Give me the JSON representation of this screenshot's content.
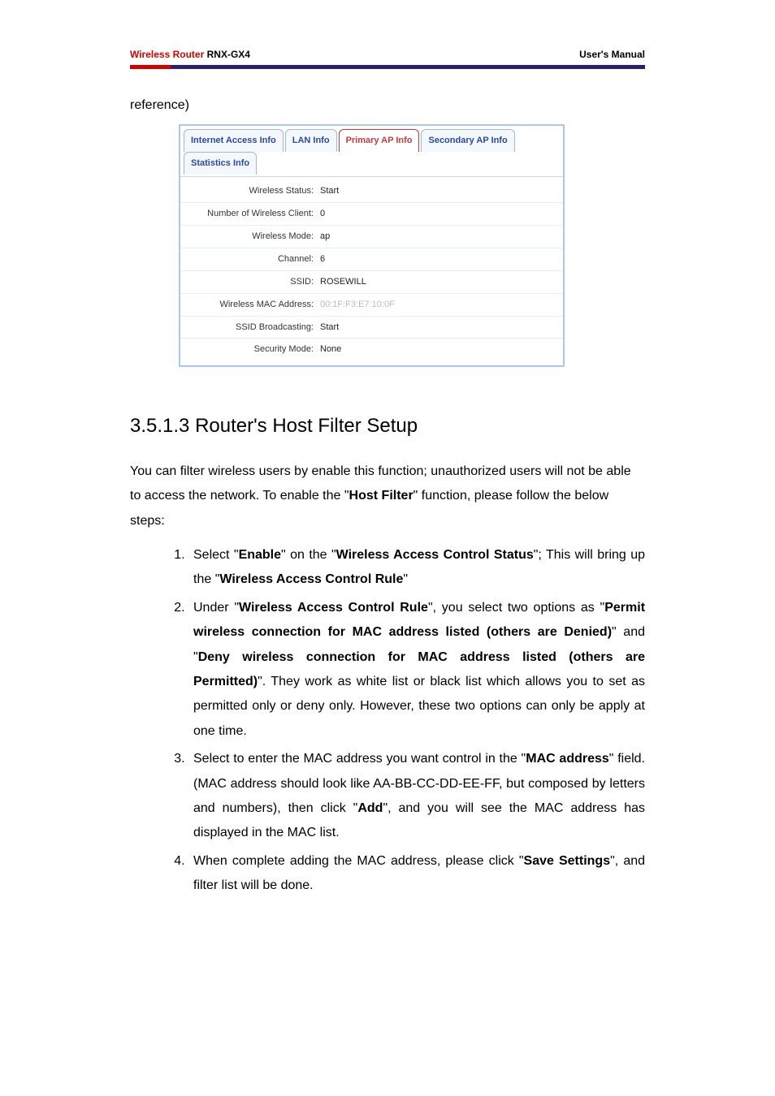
{
  "header": {
    "product_prefix": "Wireless Router",
    "model": "RNX-GX4",
    "right": "User's Manual"
  },
  "ref_line": "reference)",
  "router_ui": {
    "tabs": {
      "internet": "Internet Access Info",
      "lan": "LAN Info",
      "primary": "Primary AP Info",
      "secondary": "Secondary AP Info",
      "stats": "Statistics Info"
    },
    "rows": {
      "wireless_status_label": "Wireless Status:",
      "wireless_status_value": "Start",
      "num_client_label": "Number of Wireless Client:",
      "num_client_value": "0",
      "wireless_mode_label": "Wireless Mode:",
      "wireless_mode_value": "ap",
      "channel_label": "Channel:",
      "channel_value": "6",
      "ssid_label": "SSID:",
      "ssid_value": "ROSEWILL",
      "mac_label": "Wireless MAC Address:",
      "mac_value": "00:1F:F3:E7:10:0F",
      "broadcast_label": "SSID Broadcasting:",
      "broadcast_value": "Start",
      "security_label": "Security Mode:",
      "security_value": "None"
    }
  },
  "section_heading": "3.5.1.3 Router's Host Filter Setup",
  "intro": {
    "p1a": "You can filter wireless users by enable this function; unauthorized users will not be able to access the network. To enable the \"",
    "p1b": "Host Filter",
    "p1c": "\" function, please follow the below steps:"
  },
  "steps": {
    "s1a": "Select \"",
    "s1b": "Enable",
    "s1c": "\" on the \"",
    "s1d": "Wireless Access Control Status",
    "s1e": "\"; This will bring up the \"",
    "s1f": "Wireless Access Control Rule",
    "s1g": "\"",
    "s2a": "Under \"",
    "s2b": "Wireless Access Control Rule",
    "s2c": "\", you select two options as \"",
    "s2d": "Permit wireless connection for MAC address listed (others are Denied)",
    "s2e": "\" and \"",
    "s2f": "Deny wireless connection for MAC address listed (others are Permitted)",
    "s2g": "\". They work as white list or black list which allows you to set as permitted only or deny only. However, these two options can only be apply at one time.",
    "s3a": "Select to enter the MAC address you want control in the \"",
    "s3b": "MAC address",
    "s3c": "\" field. (MAC address should look like AA-BB-CC-DD-EE-FF, but composed by letters and numbers), then click \"",
    "s3d": "Add",
    "s3e": "\", and you will see the MAC address has displayed in the MAC list.",
    "s4a": "When complete adding the MAC address, please click \"",
    "s4b": "Save Settings",
    "s4c": "\", and filter list will be done."
  }
}
